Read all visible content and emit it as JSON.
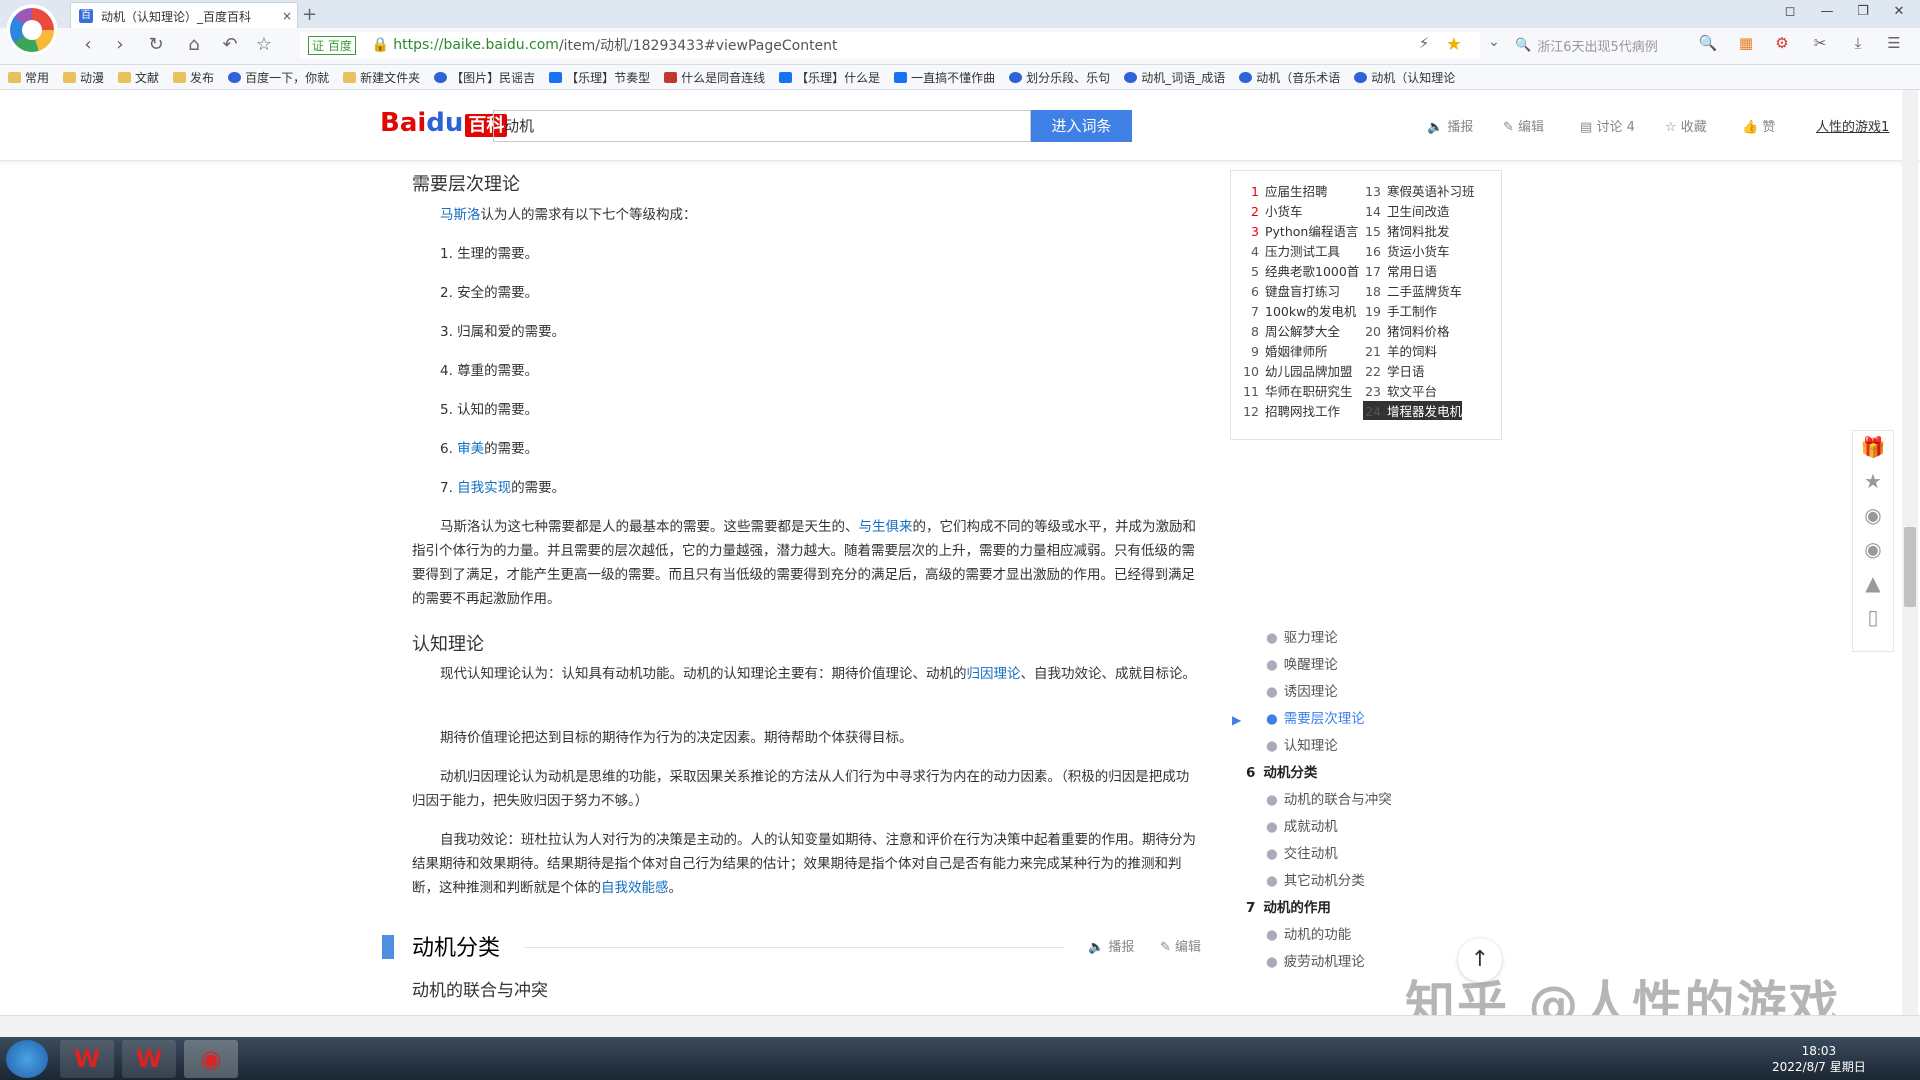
{
  "browser": {
    "tab_title": "动机（认知理论）_百度百科",
    "tab_close": "×",
    "new_tab": "+",
    "url_cert": "证 百度",
    "url_host": "https://baike.baidu.com",
    "url_path": "/item/动机/18293433#viewPageContent",
    "search_placeholder": "浙江6天出现5代病例",
    "bookmarks": [
      "常用",
      "动漫",
      "文献",
      "发布",
      "百度一下，你就",
      "新建文件夹",
      "【图片】民谣吉",
      "【乐理】节奏型",
      "什么是同音连线",
      "【乐理】什么是",
      "一直搞不懂作曲",
      "划分乐段、乐句",
      "动机_词语_成语",
      "动机（音乐术语",
      "动机（认知理论"
    ]
  },
  "baike": {
    "logo_text": "Bai",
    "logo_paw": "du",
    "logo_bk": "百科",
    "search_value": "动机",
    "search_button": "进入词条",
    "tools": [
      "播报",
      "编辑",
      "讨论 4",
      "收藏",
      "赞"
    ],
    "user_link": "人性的游戏1"
  },
  "content": {
    "h_need": "需要层次理论",
    "p_maslow_link": "马斯洛",
    "p_maslow_rest": "认为人的需求有以下七个等级构成：",
    "needs": [
      "1. 生理的需要。",
      "2. 安全的需要。",
      "3. 归属和爱的需要。",
      "4. 尊重的需要。",
      "5. 认知的需要。"
    ],
    "need6_pre": "6. ",
    "need6_link": "审美",
    "need6_post": "的需要。",
    "need7_pre": "7. ",
    "need7_link": "自我实现",
    "need7_post": "的需要。",
    "p_seven_a": "马斯洛认为这七种需要都是人的最基本的需要。这些需要都是天生的、",
    "p_seven_link": "与生俱来",
    "p_seven_b": "的，它们构成不同的等级或水平，并成为激励和指引个体行为的力量。并且需要的层次越低，它的力量越强，潜力越大。随着需要层次的上升，需要的力量相应减弱。只有低级的需要得到了满足，才能产生更高一级的需要。而且只有当低级的需要得到充分的满足后，高级的需要才显出激励的作用。已经得到满足的需要不再起激励作用。",
    "h_cog": "认知理论",
    "p_cog_a": "现代认知理论认为：认知具有动机功能。动机的认知理论主要有：期待价值理论、动机的",
    "p_cog_link": "归因理论",
    "p_cog_b": "、自我功效论、成就目标论。",
    "p_expect": "期待价值理论把达到目标的期待作为行为的决定因素。期待帮助个体获得目标。",
    "p_attr": "动机归因理论认为动机是思维的功能，采取因果关系推论的方法从人们行为中寻求行为内在的动力因素。（积极的归因是把成功归因于能力，把失败归因于努力不够。）",
    "p_eff_a": "自我功效论：班杜拉认为人对行为的决策是主动的。人的认知变量如期待、注意和评价在行为决策中起着重要的作用。期待分为结果期待和效果期待。结果期待是指个体对自己行为结果的估计；效果期待是指个体对自己是否有能力来完成某种行为的推测和判断，这种推测和判断就是个体的",
    "p_eff_link": "自我效能感",
    "p_eff_b": "。",
    "sec_title": "动机分类",
    "sec_tools": [
      "播报",
      "编辑"
    ],
    "h_conflict": "动机的联合与冲突"
  },
  "hotlist": [
    {
      "n": "1",
      "t": "应届生招聘"
    },
    {
      "n": "2",
      "t": "小货车"
    },
    {
      "n": "3",
      "t": "Python编程语言"
    },
    {
      "n": "4",
      "t": "压力测试工具"
    },
    {
      "n": "5",
      "t": "经典老歌1000首"
    },
    {
      "n": "6",
      "t": "键盘盲打练习"
    },
    {
      "n": "7",
      "t": "100kw的发电机"
    },
    {
      "n": "8",
      "t": "周公解梦大全"
    },
    {
      "n": "9",
      "t": "婚姻律师所"
    },
    {
      "n": "10",
      "t": "幼儿园品牌加盟"
    },
    {
      "n": "11",
      "t": "华师在职研究生"
    },
    {
      "n": "12",
      "t": "招聘网找工作"
    },
    {
      "n": "13",
      "t": "寒假英语补习班"
    },
    {
      "n": "14",
      "t": "卫生间改造"
    },
    {
      "n": "15",
      "t": "猪饲料批发"
    },
    {
      "n": "16",
      "t": "货运小货车"
    },
    {
      "n": "17",
      "t": "常用日语"
    },
    {
      "n": "18",
      "t": "二手蓝牌货车"
    },
    {
      "n": "19",
      "t": "手工制作"
    },
    {
      "n": "20",
      "t": "猪饲料价格"
    },
    {
      "n": "21",
      "t": "羊的饲料"
    },
    {
      "n": "22",
      "t": "学日语"
    },
    {
      "n": "23",
      "t": "软文平台"
    },
    {
      "n": "24",
      "t": "增程器发电机"
    }
  ],
  "toc": {
    "items_a": [
      "驱力理论",
      "唤醒理论",
      "诱因理论",
      "需要层次理论",
      "认知理论"
    ],
    "main6_num": "6",
    "main6": "动机分类",
    "items_b": [
      "动机的联合与冲突",
      "成就动机",
      "交往动机",
      "其它动机分类"
    ],
    "main7_num": "7",
    "main7": "动机的作用",
    "items_c": [
      "动机的功能",
      "疲劳动机理论"
    ]
  },
  "watermark": "知乎 @人性的游戏",
  "taskbar": {
    "time": "18:03",
    "date": "2022/8/7 星期日"
  }
}
